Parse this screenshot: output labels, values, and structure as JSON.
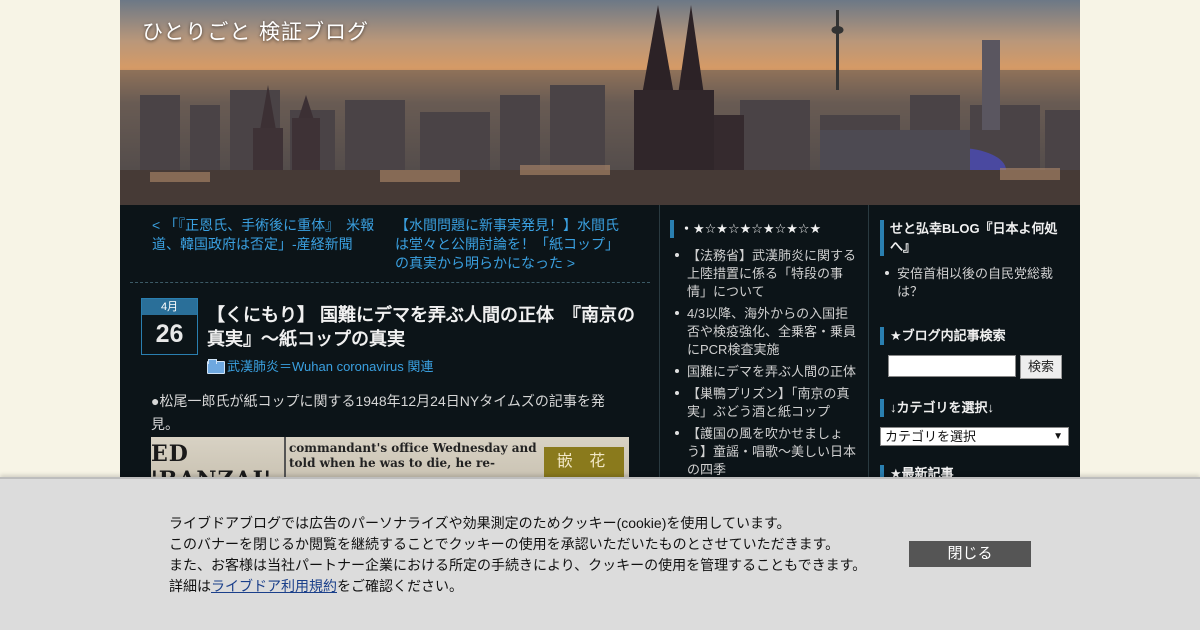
{
  "blog": {
    "title": "ひとりごと 検証ブログ"
  },
  "nav": {
    "prev": "< 「『正恩氏、手術後に重体』　米報道、韓国政府は否定」-産経新聞",
    "next": "【水間問題に新事実発見！】水間氏は堂々と公開討論を！「紙コップ」の真実から明らかになった >"
  },
  "post": {
    "month": "4月",
    "day": "26",
    "title": "【くにもり】 国難にデマを弄ぶ人間の正体　『南京の真実』～紙コップの真実",
    "category": "武漢肺炎＝Wuhan coronavirus 関連",
    "body": "●松尾一郎氏が紙コップに関する1948年12月24日NYタイムズの記事を発見。",
    "image": {
      "headline": "ED 'BANZAI'",
      "column_text": "commandant's office Wednesday and told when he was to die, he re-",
      "stamp": "嵌 花"
    }
  },
  "sidebar1": {
    "heading": "・★☆★☆★☆★☆★☆★",
    "items": [
      "【法務省】武漢肺炎に関する上陸措置に係る「特段の事情」について",
      "4/3以降、海外からの入国拒否や検疫強化、全乗客・乗員にPCR検査実施",
      "国難にデマを弄ぶ人間の正体",
      "【巣鴨プリズン】「南京の真実」ぶどう酒と紙コップ",
      "【護国の風を吹かせましょう】童謡・唱歌～美しい日本の四季"
    ]
  },
  "sidebar2": {
    "heading1": "せと弘幸BLOG『日本よ何処へ』",
    "items1": [
      "安倍首相以後の自民党総裁は？"
    ],
    "search_heading": "★ブログ内記事検索",
    "search_button": "検索",
    "category_heading": "↓カテゴリを選択↓",
    "category_select": "カテゴリを選択",
    "recent_heading": "★最新記事"
  },
  "cookie": {
    "line1": "ライブドアブログでは広告のパーソナライズや効果測定のためクッキー(cookie)を使用しています。",
    "line2": "このバナーを閉じるか閲覧を継続することでクッキーの使用を承認いただいたものとさせていただきます。",
    "line3": "また、お客様は当社パートナー企業における所定の手続きにより、クッキーの使用を管理することもできます。",
    "line4_prefix": "詳細は",
    "line4_link": "ライブドア利用規約",
    "line4_suffix": "をご確認ください。",
    "close": "閉じる"
  }
}
